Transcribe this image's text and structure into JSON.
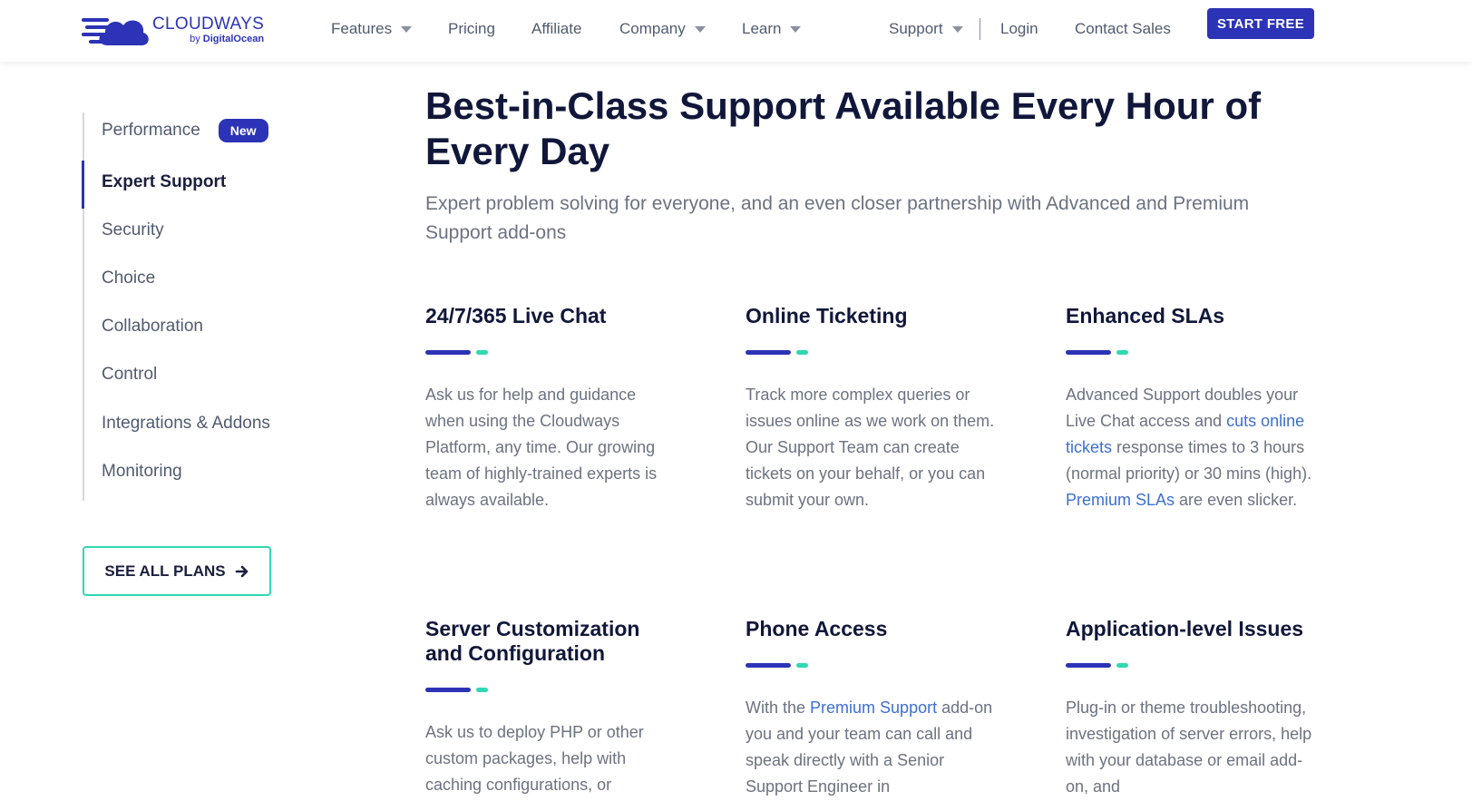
{
  "header": {
    "logo": {
      "name": "CLOUDWAYS",
      "by": "by",
      "brand": "DigitalOcean"
    },
    "nav": [
      {
        "label": "Features",
        "dropdown": true
      },
      {
        "label": "Pricing",
        "dropdown": false
      },
      {
        "label": "Affiliate",
        "dropdown": false
      },
      {
        "label": "Company",
        "dropdown": true
      },
      {
        "label": "Learn",
        "dropdown": true
      }
    ],
    "right_nav": {
      "support": "Support",
      "login": "Login",
      "contact": "Contact Sales",
      "start": "START FREE"
    }
  },
  "sidebar": {
    "items": [
      {
        "label": "Performance",
        "badge": "New",
        "active": false
      },
      {
        "label": "Expert Support",
        "active": true
      },
      {
        "label": "Security",
        "active": false
      },
      {
        "label": "Choice",
        "active": false
      },
      {
        "label": "Collaboration",
        "active": false
      },
      {
        "label": "Control",
        "active": false
      },
      {
        "label": "Integrations & Addons",
        "active": false
      },
      {
        "label": "Monitoring",
        "active": false
      }
    ],
    "see_all_plans": "SEE ALL PLANS"
  },
  "main": {
    "title": "Best-in-Class Support Available Every Hour of Every Day",
    "subtitle": "Expert problem solving for everyone, and an even closer partnership with Advanced and Premium Support add-ons",
    "cards": [
      {
        "title": "24/7/365 Live Chat",
        "body": [
          {
            "text": "Ask us for help and guidance when using the Cloudways Platform, any time. Our growing team of highly-trained experts is always available."
          }
        ]
      },
      {
        "title": "Online Ticketing",
        "body": [
          {
            "text": "Track more complex queries or issues online as we work on them. Our Support Team can create tickets on your behalf, or you can submit your own."
          }
        ]
      },
      {
        "title": "Enhanced SLAs",
        "body": [
          {
            "text": "Advanced Support doubles your Live Chat access and "
          },
          {
            "text": "cuts online tickets",
            "link": true
          },
          {
            "text": " response times to 3 hours (normal priority) or 30 mins (high). "
          },
          {
            "text": "Premium SLAs",
            "link": true
          },
          {
            "text": " are even slicker."
          }
        ]
      },
      {
        "title": "Server Customization and Configuration",
        "body": [
          {
            "text": "Ask us to deploy PHP or other custom packages, help with caching configurations, or"
          }
        ]
      },
      {
        "title": "Phone Access",
        "body": [
          {
            "text": "With the "
          },
          {
            "text": "Premium Support",
            "link": true
          },
          {
            "text": " add-on you and your team can call and speak directly with a Senior Support Engineer in"
          }
        ]
      },
      {
        "title": "Application-level Issues",
        "body": [
          {
            "text": "Plug-in or theme troubleshooting, investigation of server errors, help with your database or email add-on, and"
          }
        ]
      }
    ]
  },
  "colors": {
    "brand_blue": "#2c33b6",
    "accent_green": "#2ed9b3",
    "link_blue": "#3d6fd1",
    "heading": "#10173a",
    "body_text": "#6c7280"
  },
  "icons": [
    "cloud-logo-icon",
    "chevron-down-icon",
    "arrow-right-icon"
  ]
}
